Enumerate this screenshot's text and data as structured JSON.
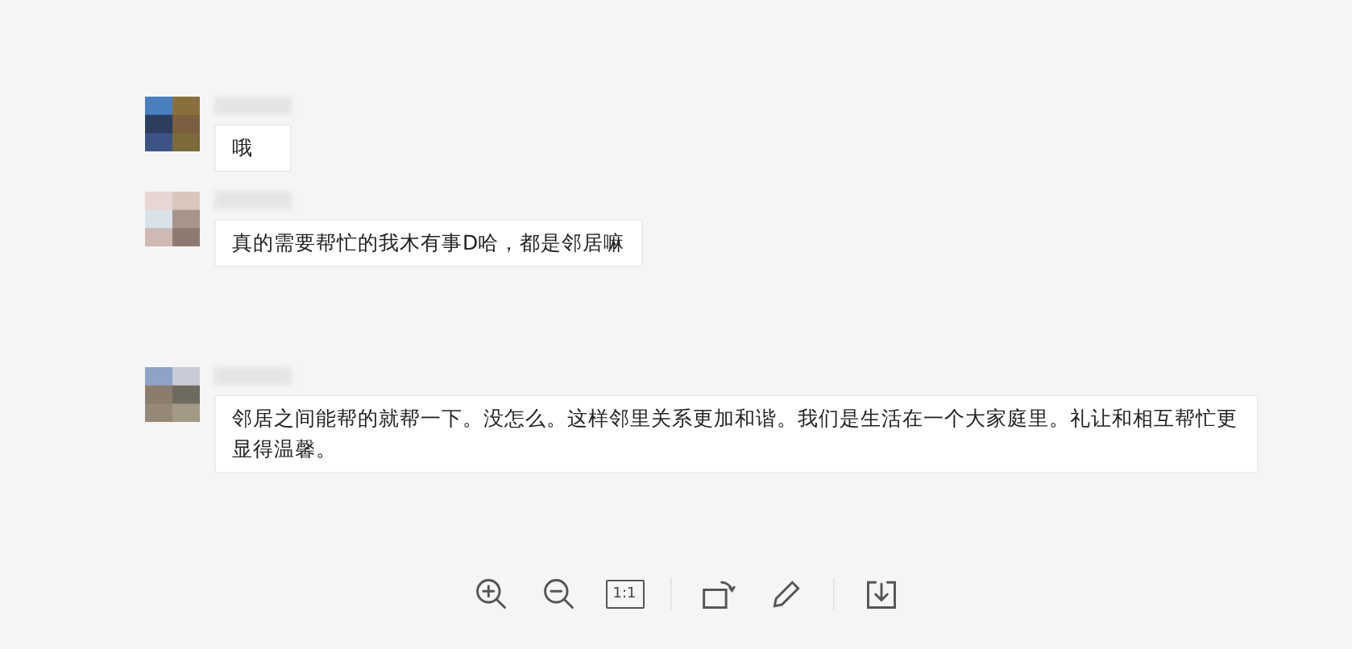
{
  "messages": [
    {
      "text": "哦"
    },
    {
      "text": "真的需要帮忙的我木有事D哈，都是邻居嘛"
    },
    {
      "text": "邻居之间能帮的就帮一下。没怎么。这样邻里关系更加和谐。我们是生活在一个大家庭里。礼让和相互帮忙更显得温馨。"
    }
  ],
  "toolbar": [
    {
      "kind": "zoom-in"
    },
    {
      "kind": "zoom-out"
    },
    {
      "kind": "actual-size",
      "label": "1:1"
    },
    {
      "kind": "divider"
    },
    {
      "kind": "rotate"
    },
    {
      "kind": "edit"
    },
    {
      "kind": "divider"
    },
    {
      "kind": "download"
    }
  ]
}
